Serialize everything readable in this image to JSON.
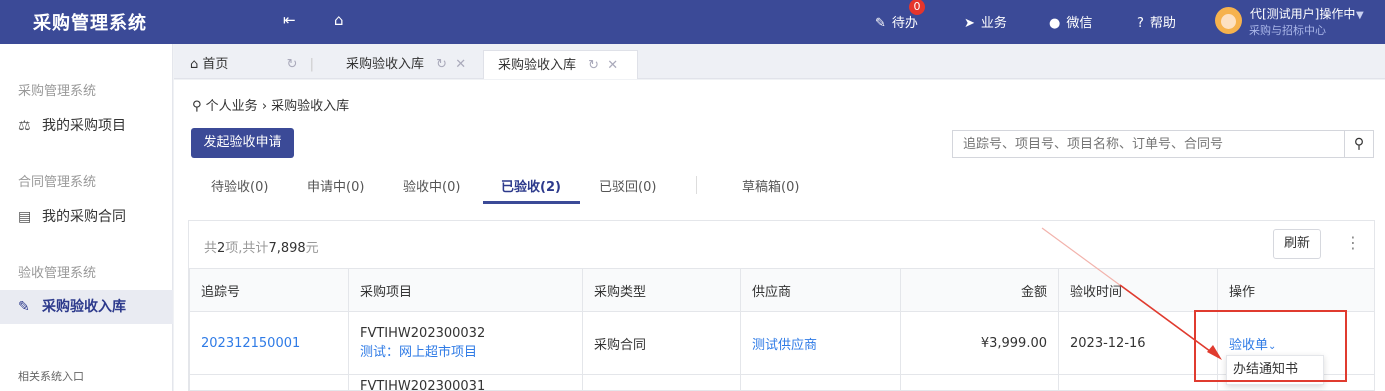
{
  "header": {
    "brand": "采购管理系统",
    "nav": [
      {
        "label": "待办",
        "badge": "0",
        "icon": "edit-icon"
      },
      {
        "label": "业务",
        "icon": "send-icon"
      },
      {
        "label": "微信",
        "icon": "wechat-icon"
      },
      {
        "label": "帮助",
        "icon": "help-icon"
      }
    ],
    "user_name": "代[测试用户]操作中",
    "user_sub": "采购与招标中心"
  },
  "sidebar": {
    "groups": [
      {
        "title": "采购管理系统",
        "item": "我的采购项目",
        "icon": "scale-icon"
      },
      {
        "title": "合同管理系统",
        "item": "我的采购合同",
        "icon": "document-icon"
      },
      {
        "title": "验收管理系统",
        "item": "采购验收入库",
        "icon": "pencil-icon"
      }
    ],
    "footer": "相关系统入口"
  },
  "page_tabs": [
    {
      "label": "首页",
      "icon": "home-icon"
    },
    {
      "label": "采购验收入库"
    },
    {
      "label": "采购验收入库"
    }
  ],
  "breadcrumb": {
    "root": "个人业务",
    "sep": "›",
    "current": "采购验收入库"
  },
  "actions": {
    "start_label": "发起验收申请",
    "search_placeholder": "追踪号、项目号、项目名称、订单号、合同号"
  },
  "status_tabs": [
    "待验收(0)",
    "申请中(0)",
    "验收中(0)",
    "已验收(2)",
    "已驳回(0)",
    "草稿箱(0)"
  ],
  "summary": {
    "prefix": "共",
    "count": "2",
    "mid": "项,共计",
    "amount": "7,898",
    "suffix": "元"
  },
  "toolbar": {
    "refresh_label": "刷新",
    "more_icon": "more-vertical-icon"
  },
  "table": {
    "headers": [
      "追踪号",
      "采购项目",
      "采购类型",
      "供应商",
      "金额",
      "验收时间",
      "操作"
    ],
    "rows": [
      {
        "track_no": "202312150001",
        "project_no": "FVTIHW202300032",
        "project_name": "测试：网上超市项目",
        "type": "采购合同",
        "supplier": "测试供应商",
        "amount": "¥3,999.00",
        "date": "2023-12-16",
        "action": "验收单"
      }
    ],
    "partial_row_text": "FVTIHW202300031"
  },
  "dropdown": {
    "item": "办结通知书"
  },
  "colors": {
    "brand": "#3b4a97",
    "link": "#2f7be6",
    "highlight": "#e03b2f"
  }
}
